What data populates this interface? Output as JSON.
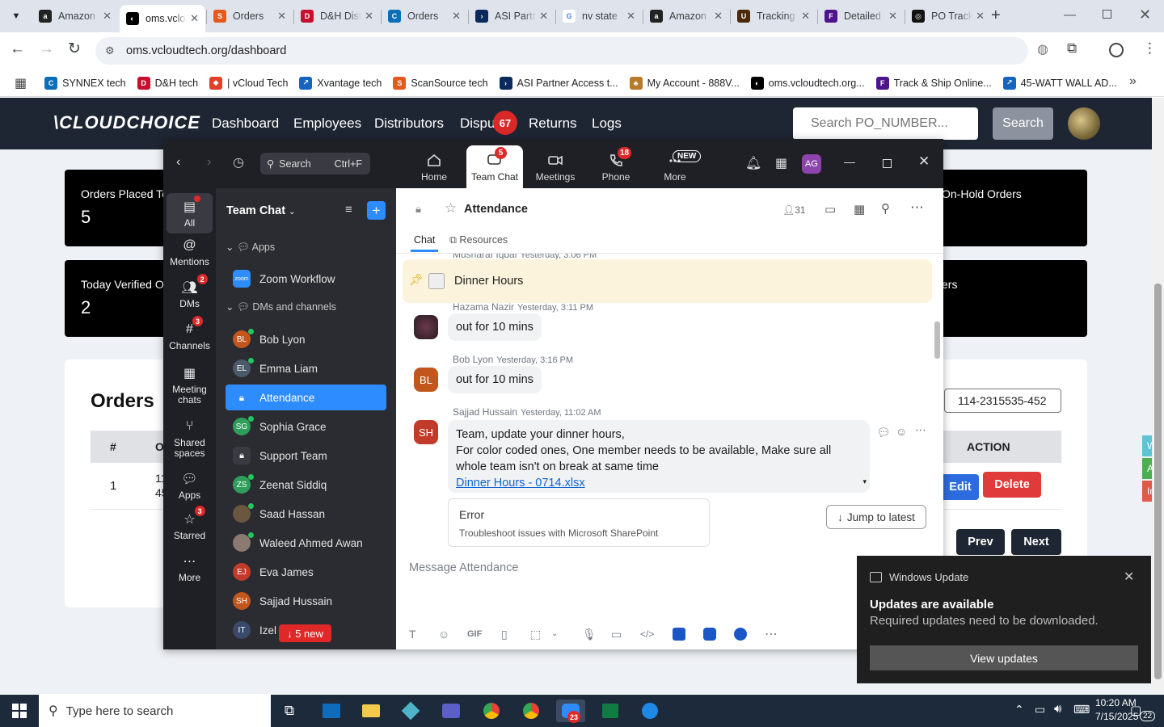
{
  "browser": {
    "tabs": [
      {
        "title": "Amazon",
        "color": "#222",
        "glyph": "a"
      },
      {
        "title": "oms.vcloudtech",
        "color": "#000",
        "glyph": "◐"
      },
      {
        "title": "Orders",
        "color": "#e55a1c",
        "glyph": "S"
      },
      {
        "title": "D&H Distributing",
        "color": "#c8102e",
        "glyph": "D"
      },
      {
        "title": "Orders",
        "color": "#0b6fb8",
        "glyph": "C"
      },
      {
        "title": "ASI Partner",
        "color": "#0a2a5c",
        "glyph": "›"
      },
      {
        "title": "nv state",
        "color": "#fff",
        "glyph": "G"
      },
      {
        "title": "Amazon",
        "color": "#222",
        "glyph": "a"
      },
      {
        "title": "Tracking",
        "color": "#4a2a0a",
        "glyph": "U"
      },
      {
        "title": "Detailed",
        "color": "#4d148c",
        "glyph": "F"
      },
      {
        "title": "PO Tracker",
        "color": "#111",
        "glyph": "◎"
      }
    ],
    "url": "oms.vcloudtech.org/dashboard",
    "bookmarks": [
      {
        "label": "SYNNEX tech",
        "color": "#0b6fb8",
        "glyph": "C"
      },
      {
        "label": "D&H tech",
        "color": "#c8102e",
        "glyph": "D"
      },
      {
        "label": "| vCloud Tech",
        "color": "#e2402c",
        "glyph": "◆"
      },
      {
        "label": "Xvantage tech",
        "color": "#1565c0",
        "glyph": "↗"
      },
      {
        "label": "ScanSource tech",
        "color": "#e55a1c",
        "glyph": "S"
      },
      {
        "label": "ASI Partner Access t...",
        "color": "#0a2a5c",
        "glyph": "›"
      },
      {
        "label": "My Account - 888V...",
        "color": "#b7792a",
        "glyph": "♣"
      },
      {
        "label": "oms.vcloudtech.org...",
        "color": "#000",
        "glyph": "◐"
      },
      {
        "label": "Track & Ship Online...",
        "color": "#4d148c",
        "glyph": "F"
      },
      {
        "label": "45-WATT WALL AD...",
        "color": "#1565c0",
        "glyph": "↗"
      }
    ]
  },
  "site": {
    "logo": "\\CLOUDCHOICE",
    "nav": [
      "Dashboard",
      "Employees",
      "Distributors",
      "Dispu",
      "Returns",
      "Logs"
    ],
    "disputes_badge": "67",
    "search_placeholder": "Search PO_NUMBER...",
    "search_button": "Search",
    "cards": [
      {
        "label": "Orders Placed To",
        "value": "5"
      },
      {
        "label": "Today Verified O",
        "value": "2"
      },
      {
        "label": "On-Hold Orders",
        "value": ""
      },
      {
        "label": "ers",
        "value": ""
      }
    ],
    "orders_title": "Orders",
    "table_headers": [
      "#",
      "O",
      "ACTION"
    ],
    "row": {
      "num": "1",
      "order_a": "11",
      "order_b": "45"
    },
    "filter_value": "114-2315535-452",
    "edit": "Edit",
    "delete": "Delete",
    "prev": "Prev",
    "next": "Next",
    "right_tabs": [
      "W",
      "Ac",
      "In"
    ]
  },
  "zoom": {
    "search_label": "Search",
    "search_shortcut": "Ctrl+F",
    "tabs": [
      {
        "label": "Home",
        "badge": ""
      },
      {
        "label": "Team Chat",
        "badge": "5"
      },
      {
        "label": "Meetings",
        "badge": ""
      },
      {
        "label": "Phone",
        "badge": "18"
      },
      {
        "label": "More",
        "badge": "NEW"
      }
    ],
    "avatar": "AG",
    "rail": [
      {
        "label": "All",
        "badge": ""
      },
      {
        "label": "Mentions",
        "badge": ""
      },
      {
        "label": "DMs",
        "badge": "2"
      },
      {
        "label": "Channels",
        "badge": "3"
      },
      {
        "label": "Meeting chats",
        "badge": ""
      },
      {
        "label": "Shared spaces",
        "badge": ""
      },
      {
        "label": "Apps",
        "badge": ""
      },
      {
        "label": "Starred",
        "badge": "3"
      },
      {
        "label": "More",
        "badge": ""
      }
    ],
    "list_title": "Team Chat",
    "section_apps": "Apps",
    "zoom_workflow": "Zoom Workflow",
    "section_dms": "DMs and channels",
    "contacts": [
      {
        "name": "Bob Lyon",
        "initials": "BL",
        "color": "#c2561c",
        "online": true
      },
      {
        "name": "Emma Liam",
        "initials": "EL",
        "color": "#4a5a6a",
        "online": true
      },
      {
        "name": "Attendance",
        "initials": "",
        "color": "",
        "online": false
      },
      {
        "name": "Sophia Grace",
        "initials": "SG",
        "color": "#2f9e5a",
        "online": true
      },
      {
        "name": "Support Team",
        "initials": "",
        "color": "#555",
        "online": false
      },
      {
        "name": "Zeenat Siddiq",
        "initials": "ZS",
        "color": "#2f9e5a",
        "online": true
      },
      {
        "name": "Saad Hassan",
        "initials": "",
        "color": "#6b5640",
        "online": true
      },
      {
        "name": "Waleed Ahmed Awan",
        "initials": "",
        "color": "#8a7a70",
        "online": true
      },
      {
        "name": "Eva James",
        "initials": "EJ",
        "color": "#c23a2a",
        "online": false
      },
      {
        "name": "Sajjad Hussain",
        "initials": "SH",
        "color": "#c2561c",
        "online": false
      },
      {
        "name": "Izel",
        "initials": "IT",
        "color": "#3a4a6a",
        "online": false
      }
    ],
    "new_pill": "↓ 5 new",
    "channel": "Attendance",
    "members": "31",
    "chat_tab": "Chat",
    "resources_tab": "Resources",
    "cut_name": "Musharaf Iqbal",
    "cut_time": "Yesterday, 3:06 PM",
    "pinned": "Dinner Hours",
    "messages": [
      {
        "name": "Hazama Nazir",
        "time": "Yesterday, 3:11 PM",
        "text": "out for 10 mins"
      },
      {
        "name": "Bob Lyon",
        "time": "Yesterday, 3:16 PM",
        "text": "out for 10 mins",
        "initials": "BL"
      },
      {
        "name": "Sajjad Hussain",
        "time": "Yesterday, 11:02 AM",
        "initials": "SH",
        "line1": "Team, update your dinner hours,",
        "line2": "For color coded ones, One member needs to be available, Make sure all",
        "line3": "whole team isn't on break at same time",
        "link": "Dinner Hours - 0714.xlsx"
      }
    ],
    "error_title": "Error",
    "error_sub": "Troubleshoot issues with Microsoft SharePoint",
    "jump": "Jump to latest",
    "composer_placeholder": "Message Attendance",
    "gif": "GIF"
  },
  "windows_update": {
    "app": "Windows Update",
    "title": "Updates are available",
    "body": "Required updates need to be downloaded.",
    "button": "View updates"
  },
  "taskbar": {
    "search": "Type here to search",
    "time": "10:20 AM",
    "date": "7/15/2025",
    "zoom_badge": "23",
    "notif_count": "22"
  }
}
